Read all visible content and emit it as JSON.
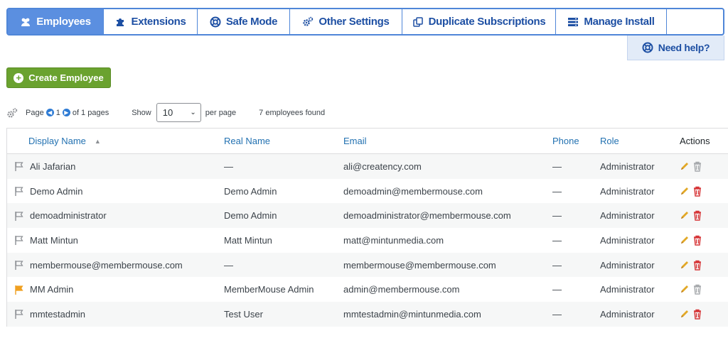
{
  "tabs": [
    {
      "label": "Employees",
      "icon": "users-icon",
      "active": true
    },
    {
      "label": "Extensions",
      "icon": "puzzle-icon"
    },
    {
      "label": "Safe Mode",
      "icon": "lifebuoy-icon"
    },
    {
      "label": "Other Settings",
      "icon": "gears-icon"
    },
    {
      "label": "Duplicate Subscriptions",
      "icon": "copy-icon"
    },
    {
      "label": "Manage Install",
      "icon": "server-icon"
    }
  ],
  "help": {
    "label": "Need help?",
    "icon": "lifebuoy-icon"
  },
  "create_button": {
    "label": "Create Employee",
    "icon": "plus-circle-icon"
  },
  "pager": {
    "page_label": "Page",
    "current_page": "1",
    "of_pages": "of 1 pages",
    "show_label": "Show",
    "per_page_value": "10",
    "per_page_label": "per page",
    "found": "7 employees found"
  },
  "columns": {
    "display_name": "Display Name",
    "real_name": "Real Name",
    "email": "Email",
    "phone": "Phone",
    "role": "Role",
    "actions": "Actions"
  },
  "rows": [
    {
      "display_name": "Ali Jafarian",
      "real_name": "—",
      "email": "ali@creatency.com",
      "phone": "—",
      "role": "Administrator",
      "flag": "gray",
      "delete_enabled": false
    },
    {
      "display_name": "Demo Admin",
      "real_name": "Demo Admin",
      "email": "demoadmin@membermouse.com",
      "phone": "—",
      "role": "Administrator",
      "flag": "gray",
      "delete_enabled": true
    },
    {
      "display_name": "demoadministrator",
      "real_name": "Demo Admin",
      "email": "demoadministrator@membermouse.com",
      "phone": "—",
      "role": "Administrator",
      "flag": "gray",
      "delete_enabled": true
    },
    {
      "display_name": "Matt Mintun",
      "real_name": "Matt Mintun",
      "email": "matt@mintunmedia.com",
      "phone": "—",
      "role": "Administrator",
      "flag": "gray",
      "delete_enabled": true
    },
    {
      "display_name": "membermouse@membermouse.com",
      "real_name": "—",
      "email": "membermouse@membermouse.com",
      "phone": "—",
      "role": "Administrator",
      "flag": "gray",
      "delete_enabled": true
    },
    {
      "display_name": "MM Admin",
      "real_name": "MemberMouse Admin",
      "email": "admin@membermouse.com",
      "phone": "—",
      "role": "Administrator",
      "flag": "orange",
      "delete_enabled": false
    },
    {
      "display_name": "mmtestadmin",
      "real_name": "Test User",
      "email": "mmtestadmin@mintunmedia.com",
      "phone": "—",
      "role": "Administrator",
      "flag": "gray",
      "delete_enabled": true
    }
  ],
  "colors": {
    "accent": "#5b8fe0",
    "tab_text": "#1d4fa3",
    "create_green": "#6aa22f",
    "link": "#2271b1",
    "flag_orange": "#f0a020",
    "edit_yellow": "#e2a826",
    "delete_red": "#d63638"
  }
}
